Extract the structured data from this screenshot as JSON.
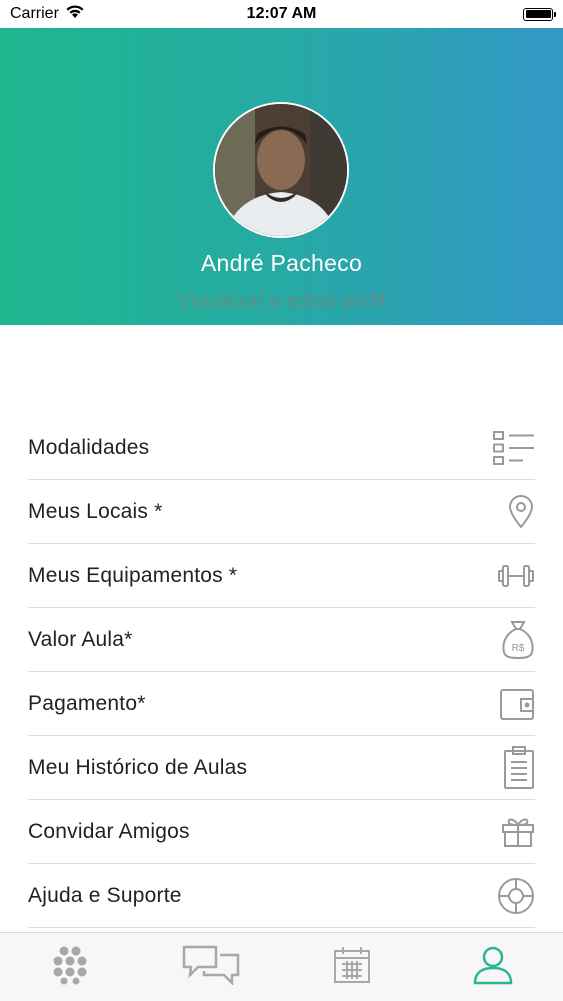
{
  "status_bar": {
    "carrier": "Carrier",
    "time": "12:07 AM",
    "battery_level": 1.0
  },
  "profile": {
    "name": "André Pacheco",
    "edit_link": "Visualizar e editar perfil",
    "gradient_colors": [
      "#1fb78f",
      "#3398c6"
    ]
  },
  "menu": {
    "items": [
      {
        "label": "Modalidades",
        "icon": "list-icon"
      },
      {
        "label": "Meus Locais *",
        "icon": "location-pin-icon"
      },
      {
        "label": "Meus Equipamentos *",
        "icon": "dumbbell-icon"
      },
      {
        "label": "Valor Aula*",
        "icon": "money-bag-icon"
      },
      {
        "label": "Pagamento*",
        "icon": "wallet-icon"
      },
      {
        "label": "Meu Histórico de Aulas",
        "icon": "clipboard-icon"
      },
      {
        "label": "Convidar Amigos",
        "icon": "gift-icon"
      },
      {
        "label": "Ajuda e Suporte",
        "icon": "lifebuoy-icon"
      }
    ],
    "icon_color": "#9a9a9a"
  },
  "tab_bar": {
    "tabs": [
      {
        "icon": "grid-dots-icon",
        "active": false
      },
      {
        "icon": "chat-icon",
        "active": false
      },
      {
        "icon": "calendar-icon",
        "active": false
      },
      {
        "icon": "profile-icon",
        "active": true
      }
    ],
    "active_color": "#2bb596",
    "inactive_color": "#a8a8a8"
  }
}
